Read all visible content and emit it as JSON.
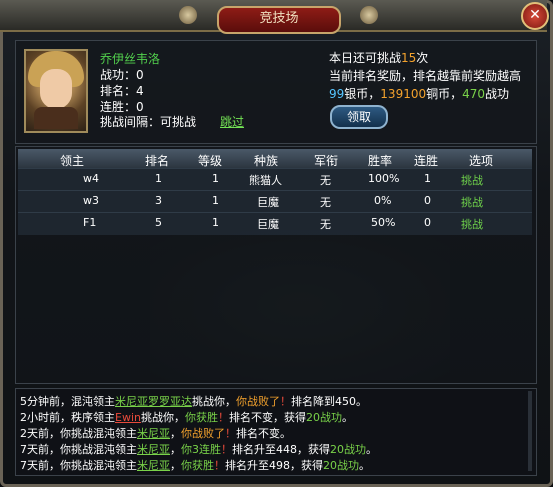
{
  "window": {
    "title": "竞技场",
    "close_icon": "close-icon"
  },
  "player": {
    "name": "乔伊丝韦洛",
    "merit": "战功：0",
    "rank": "排名：4",
    "win_streak": "连胜：0",
    "interval_label": "挑战间隔：可挑战",
    "skip_label": "跳过"
  },
  "ranking_reward": {
    "line1_prefix": "本日还可挑战",
    "line1_count": "15",
    "line1_suffix": "次",
    "line2": "当前排名奖励，排名越靠前奖励越高",
    "silver": "99",
    "silver_unit": "银币，",
    "copper": "139100",
    "copper_unit": "铜币，",
    "merit": "470",
    "merit_unit": "战功",
    "claim_button": "领取"
  },
  "table": {
    "headers": [
      "领主",
      "排名",
      "等级",
      "种族",
      "军衔",
      "胜率",
      "连胜",
      "选项"
    ],
    "rows": [
      {
        "lord": "w4",
        "rank": "1",
        "level": "1",
        "race": "熊猫人",
        "title": "无",
        "win_rate": "100%",
        "streak": "1",
        "option": "挑战"
      },
      {
        "lord": "w3",
        "rank": "3",
        "level": "1",
        "race": "巨魔",
        "title": "无",
        "win_rate": "0%",
        "streak": "0",
        "option": "挑战"
      },
      {
        "lord": "F1",
        "rank": "5",
        "level": "1",
        "race": "巨魔",
        "title": "无",
        "win_rate": "50%",
        "streak": "0",
        "option": "挑战"
      }
    ]
  },
  "log": [
    {
      "parts": [
        {
          "text": "5分钟前，混沌领主",
          "cls": ""
        },
        {
          "text": "米尼亚罗罗亚达",
          "cls": "green ul"
        },
        {
          "text": "挑战你，",
          "cls": ""
        },
        {
          "text": "你战败了",
          "cls": "orange"
        },
        {
          "text": "！",
          "cls": "red"
        },
        {
          "text": "排名降到450。",
          "cls": ""
        }
      ]
    },
    {
      "parts": [
        {
          "text": "2小时前，秩序领主",
          "cls": ""
        },
        {
          "text": "Ewin",
          "cls": "red ul"
        },
        {
          "text": "挑战你，",
          "cls": ""
        },
        {
          "text": "你获胜",
          "cls": "green"
        },
        {
          "text": "！",
          "cls": "red"
        },
        {
          "text": "排名不变，获得",
          "cls": ""
        },
        {
          "text": "20战功",
          "cls": "green"
        },
        {
          "text": "。",
          "cls": ""
        }
      ]
    },
    {
      "parts": [
        {
          "text": "2天前，你挑战混沌领主",
          "cls": ""
        },
        {
          "text": "米尼亚",
          "cls": "green ul"
        },
        {
          "text": "，",
          "cls": ""
        },
        {
          "text": "你战败了",
          "cls": "orange"
        },
        {
          "text": "！",
          "cls": "red"
        },
        {
          "text": "排名不变。",
          "cls": ""
        }
      ]
    },
    {
      "parts": [
        {
          "text": "7天前，你挑战混沌领主",
          "cls": ""
        },
        {
          "text": "米尼亚",
          "cls": "green ul"
        },
        {
          "text": "，",
          "cls": ""
        },
        {
          "text": "你3连胜",
          "cls": "green"
        },
        {
          "text": "！",
          "cls": "red"
        },
        {
          "text": "排名升至448，获得",
          "cls": ""
        },
        {
          "text": "20战功",
          "cls": "green"
        },
        {
          "text": "。",
          "cls": ""
        }
      ]
    },
    {
      "parts": [
        {
          "text": "7天前，你挑战混沌领主",
          "cls": ""
        },
        {
          "text": "米尼亚",
          "cls": "green ul"
        },
        {
          "text": "，",
          "cls": ""
        },
        {
          "text": "你获胜",
          "cls": "green"
        },
        {
          "text": "！",
          "cls": "red"
        },
        {
          "text": "排名升至498，获得",
          "cls": ""
        },
        {
          "text": "20战功",
          "cls": "green"
        },
        {
          "text": "。",
          "cls": ""
        }
      ]
    }
  ]
}
